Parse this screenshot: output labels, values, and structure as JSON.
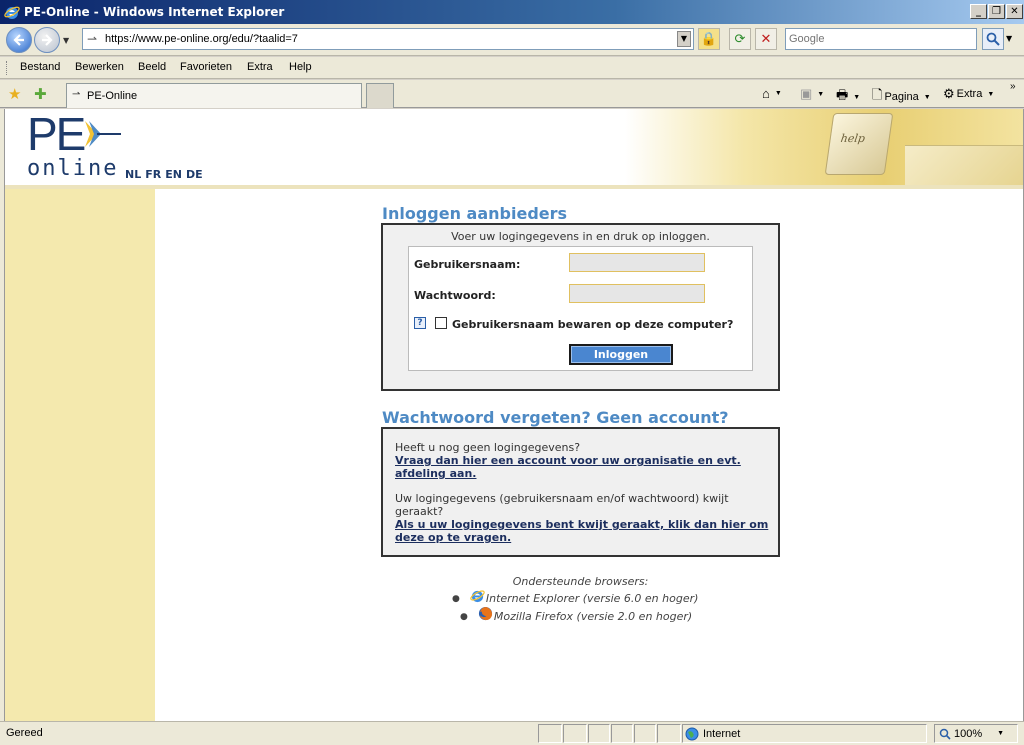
{
  "window": {
    "title": "PE-Online - Windows Internet Explorer",
    "controls": {
      "minimize": "_",
      "maximize": "❐",
      "close": "✕"
    }
  },
  "addressbar": {
    "url": "https://www.pe-online.org/edu/?taalid=7",
    "search_placeholder": "Google"
  },
  "menu": [
    "Bestand",
    "Bewerken",
    "Beeld",
    "Favorieten",
    "Extra",
    "Help"
  ],
  "tab": {
    "title": "PE-Online"
  },
  "commandbar": {
    "page_label": "Pagina",
    "tools_label": "Extra"
  },
  "site": {
    "logo_top": "PE",
    "logo_bottom": "online",
    "languages": [
      "NL",
      "FR",
      "EN",
      "DE"
    ],
    "banner_key_text": "help"
  },
  "login": {
    "heading": "Inloggen aanbieders",
    "intro": "Voer uw logingegevens in en druk op inloggen.",
    "username_label": "Gebruikersnaam:",
    "password_label": "Wachtwoord:",
    "help_icon": "?",
    "remember_label": "Gebruikersnaam bewaren op deze computer?",
    "button_label": "Inloggen"
  },
  "forgot": {
    "heading": "Wachtwoord vergeten? Geen account?",
    "no_account_text": "Heeft u nog geen logingegevens?",
    "no_account_link": "Vraag dan hier een account voor uw organisatie en evt. afdeling aan.",
    "lost_text": "Uw logingegevens (gebruikersnaam en/of wachtwoord) kwijt geraakt?",
    "lost_link": "Als u uw logingegevens bent kwijt geraakt, klik dan hier om deze op te vragen."
  },
  "browsers": {
    "header": "Ondersteunde browsers:",
    "items": [
      {
        "name": "Internet Explorer (versie 6.0 en hoger)",
        "icon": "ie-icon"
      },
      {
        "name": "Mozilla Firefox (versie 2.0 en hoger)",
        "icon": "firefox-icon"
      }
    ]
  },
  "statusbar": {
    "status": "Gereed",
    "zone": "Internet",
    "zoom": "100%"
  },
  "colors": {
    "heading_blue": "#4e8ac4",
    "sidebar_yellow": "#f4e9ae",
    "logo_navy": "#1e3b6b",
    "button_blue": "#4a86d0"
  }
}
